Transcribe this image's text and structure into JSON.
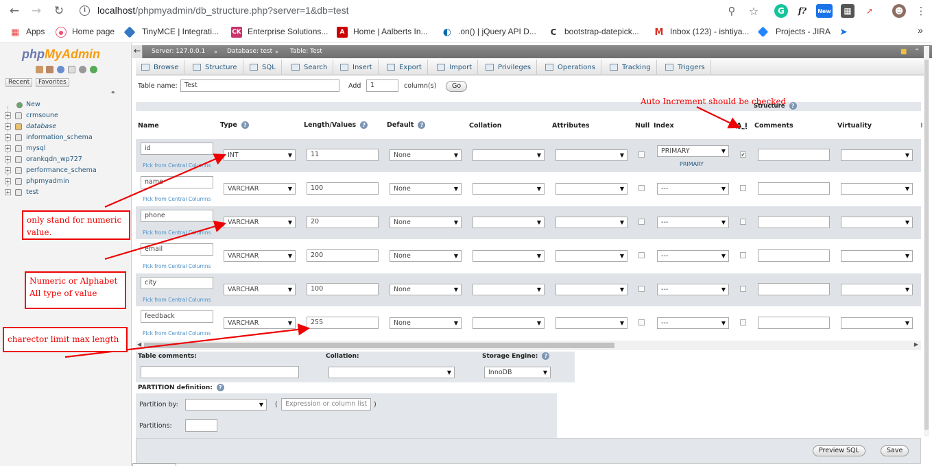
{
  "browser": {
    "url_main": "localhost",
    "url_path": "/phpmyadmin/db_structure.php?server=1&db=test",
    "bookmarks": [
      {
        "label": "Apps"
      },
      {
        "label": "Home page"
      },
      {
        "label": "TinyMCE | Integrati..."
      },
      {
        "label": "Enterprise Solutions..."
      },
      {
        "label": "Home | Aalberts In..."
      },
      {
        "label": ".on() | jQuery API D..."
      },
      {
        "label": "bootstrap-datepick..."
      },
      {
        "label": "Inbox (123) - ishtiya..."
      },
      {
        "label": "Projects - JIRA"
      }
    ],
    "more": "»",
    "new_badge": "New"
  },
  "sidebar": {
    "logo_php": "php",
    "logo_my": "MyAdmin",
    "recent": "Recent",
    "favorites": "Favorites",
    "tree": [
      "New",
      "crmsoune",
      "database",
      "information_schema",
      "mysql",
      "orankqdn_wp727",
      "performance_schema",
      "phpmyadmin",
      "test"
    ]
  },
  "crumb": {
    "back": "←",
    "server": "Server: 127.0.0.1",
    "database": "Database: test",
    "table": "Table: Test"
  },
  "tabs": [
    "Browse",
    "Structure",
    "SQL",
    "Search",
    "Insert",
    "Export",
    "Import",
    "Privileges",
    "Operations",
    "Tracking",
    "Triggers"
  ],
  "form": {
    "table_name_label": "Table name:",
    "table_name_value": "Test",
    "add_label": "Add",
    "add_value": "1",
    "columns_label": "column(s)",
    "go": "Go",
    "structure_label": "Structure"
  },
  "headers": {
    "name": "Name",
    "type": "Type",
    "length": "Length/Values",
    "default": "Default",
    "collation": "Collation",
    "attributes": "Attributes",
    "null": "Null",
    "index": "Index",
    "ai": "A_I",
    "comments": "Comments",
    "virtuality": "Virtuality"
  },
  "pick_central": "Pick from Central Columns",
  "rows": [
    {
      "name": "id",
      "type": "INT",
      "length": "11",
      "default": "None",
      "index": "PRIMARY",
      "index_note": "PRIMARY",
      "ai": "✔"
    },
    {
      "name": "name",
      "type": "VARCHAR",
      "length": "100",
      "default": "None",
      "index": "---",
      "index_note": "",
      "ai": ""
    },
    {
      "name": "phone",
      "type": "VARCHAR",
      "length": "20",
      "default": "None",
      "index": "---",
      "index_note": "",
      "ai": ""
    },
    {
      "name": "email",
      "type": "VARCHAR",
      "length": "200",
      "default": "None",
      "index": "---",
      "index_note": "",
      "ai": ""
    },
    {
      "name": "city",
      "type": "VARCHAR",
      "length": "100",
      "default": "None",
      "index": "---",
      "index_note": "",
      "ai": ""
    },
    {
      "name": "feedback",
      "type": "VARCHAR",
      "length": "255",
      "default": "None",
      "index": "---",
      "index_note": "",
      "ai": ""
    }
  ],
  "bottom": {
    "table_comments": "Table comments:",
    "collation": "Collation:",
    "storage_engine": "Storage Engine:",
    "engine_value": "InnoDB",
    "partition_def": "PARTITION definition:",
    "partition_by": "Partition by:",
    "expr_placeholder": "Expression or column list",
    "paren_open": "(",
    "paren_close": ")",
    "partitions": "Partitions:",
    "preview_sql": "Preview SQL",
    "save": "Save"
  },
  "annotations": {
    "numeric": "only stand for numeric value.",
    "alpha": "Numeric or Alphabet All type of value",
    "charlimit": "charector limit max length",
    "autoinc": "Auto Increment should be checked"
  },
  "colors": {
    "accent": "#235a81",
    "annotation": "#ee0000",
    "header_bar": "#7a7a7a"
  }
}
